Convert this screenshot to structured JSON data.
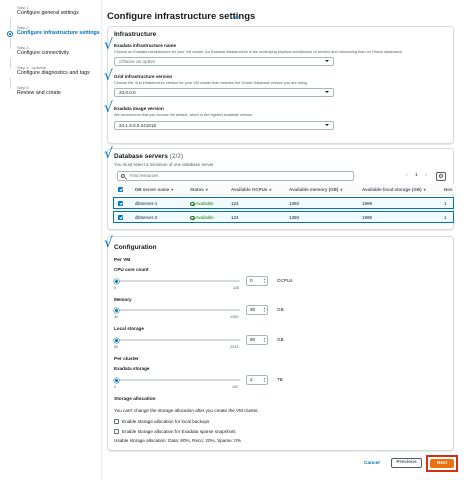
{
  "steps": [
    {
      "num": "Step 1",
      "name": "Configure general settings",
      "state": "done"
    },
    {
      "num": "Step 2",
      "name": "Configure infrastructure settings",
      "state": "active"
    },
    {
      "num": "Step 3",
      "name": "Configure connectivity",
      "state": "todo"
    },
    {
      "num": "Step 4 - optional",
      "name": "Configure diagnostics and tags",
      "state": "todo"
    },
    {
      "num": "Step 5",
      "name": "Review and create",
      "state": "todo"
    }
  ],
  "header": {
    "title": "Configure infrastructure settings",
    "info": "Info"
  },
  "infrastructure": {
    "title": "Infrastructure",
    "exadata_infra": {
      "label": "Exadata infrastructure name",
      "desc": "Choose an Exadata infrastructure for your VM cluster. An Exadata infrastructure is the underlying physical architecture of servers and networking that run Oracle databases.",
      "placeholder": "Choose an option"
    },
    "grid_version": {
      "label": "Grid infrastructure version",
      "desc": "Choose the Grid infrastructure version for your VM cluster that matches the Oracle Database version you are using.",
      "value": "23.0.0.0"
    },
    "image_version": {
      "label": "Exadata image version",
      "desc": "We recommend that you choose the default, which is the highest available version.",
      "value": "24.1.5.0.0.241016"
    }
  },
  "db_servers": {
    "title": "Database servers",
    "count": "(2/2)",
    "desc": "You must select a minimum of one database server.",
    "search_placeholder": "Find resources",
    "page": "1",
    "columns": [
      "DB server name",
      "Status",
      "Available OCPUs",
      "Available memory (GB)",
      "Available local storage (GB)",
      "Hos"
    ],
    "rows": [
      {
        "name": "dbServer-1",
        "status": "Available",
        "ocpus": "124",
        "memory": "1360",
        "storage": "1999",
        "hos": "1"
      },
      {
        "name": "dbServer-2",
        "status": "Available",
        "ocpus": "124",
        "memory": "1360",
        "storage": "1999",
        "hos": "1"
      }
    ]
  },
  "configuration": {
    "title": "Configuration",
    "per_vm": "Per VM",
    "cpu": {
      "label": "CPU core count",
      "min": "0",
      "max": "126",
      "value": "0",
      "unit": "OCPUs",
      "fill": 0.0
    },
    "memory": {
      "label": "Memory",
      "min": "30",
      "max": "1390",
      "value": "30",
      "unit": "GB",
      "fill": 0.0
    },
    "local_storage": {
      "label": "Local storage",
      "min": "60",
      "max": "2243",
      "value": "60",
      "unit": "GB",
      "fill": 0.0
    },
    "per_cluster": "Per cluster",
    "exadata_storage": {
      "label": "Exadata storage",
      "min": "2",
      "max": "192",
      "value": "2",
      "unit": "TB",
      "fill": 0.0
    },
    "storage_alloc": {
      "title": "Storage allocation",
      "desc": "You can't change the storage allocation after you create the VM cluster.",
      "opt1": "Enable storage allocation for local backups",
      "opt2": "Enable storage allocation for Exadata sparse snapshots",
      "usable": "Usable storage allocation: Data: 80%, Reco: 20%, Sparse: 0%"
    }
  },
  "footer": {
    "cancel": "Cancel",
    "previous": "Previous",
    "next": "Next"
  },
  "colors": {
    "accent": "#0073bb",
    "primary_button": "#ec7211",
    "highlight": "#d13212",
    "available": "#1d8102"
  },
  "icons": [
    "check-icon",
    "search-icon",
    "gear-icon",
    "caret-down-icon",
    "available-status-icon"
  ]
}
